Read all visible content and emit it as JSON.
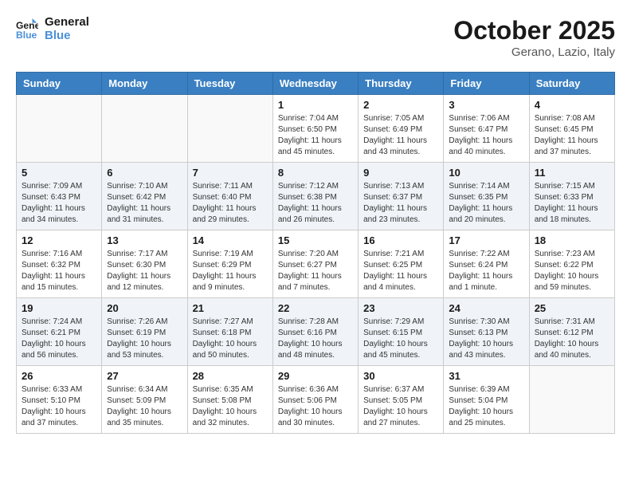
{
  "header": {
    "logo_line1": "General",
    "logo_line2": "Blue",
    "month": "October 2025",
    "location": "Gerano, Lazio, Italy"
  },
  "weekdays": [
    "Sunday",
    "Monday",
    "Tuesday",
    "Wednesday",
    "Thursday",
    "Friday",
    "Saturday"
  ],
  "weeks": [
    [
      {
        "day": "",
        "info": ""
      },
      {
        "day": "",
        "info": ""
      },
      {
        "day": "",
        "info": ""
      },
      {
        "day": "1",
        "info": "Sunrise: 7:04 AM\nSunset: 6:50 PM\nDaylight: 11 hours\nand 45 minutes."
      },
      {
        "day": "2",
        "info": "Sunrise: 7:05 AM\nSunset: 6:49 PM\nDaylight: 11 hours\nand 43 minutes."
      },
      {
        "day": "3",
        "info": "Sunrise: 7:06 AM\nSunset: 6:47 PM\nDaylight: 11 hours\nand 40 minutes."
      },
      {
        "day": "4",
        "info": "Sunrise: 7:08 AM\nSunset: 6:45 PM\nDaylight: 11 hours\nand 37 minutes."
      }
    ],
    [
      {
        "day": "5",
        "info": "Sunrise: 7:09 AM\nSunset: 6:43 PM\nDaylight: 11 hours\nand 34 minutes."
      },
      {
        "day": "6",
        "info": "Sunrise: 7:10 AM\nSunset: 6:42 PM\nDaylight: 11 hours\nand 31 minutes."
      },
      {
        "day": "7",
        "info": "Sunrise: 7:11 AM\nSunset: 6:40 PM\nDaylight: 11 hours\nand 29 minutes."
      },
      {
        "day": "8",
        "info": "Sunrise: 7:12 AM\nSunset: 6:38 PM\nDaylight: 11 hours\nand 26 minutes."
      },
      {
        "day": "9",
        "info": "Sunrise: 7:13 AM\nSunset: 6:37 PM\nDaylight: 11 hours\nand 23 minutes."
      },
      {
        "day": "10",
        "info": "Sunrise: 7:14 AM\nSunset: 6:35 PM\nDaylight: 11 hours\nand 20 minutes."
      },
      {
        "day": "11",
        "info": "Sunrise: 7:15 AM\nSunset: 6:33 PM\nDaylight: 11 hours\nand 18 minutes."
      }
    ],
    [
      {
        "day": "12",
        "info": "Sunrise: 7:16 AM\nSunset: 6:32 PM\nDaylight: 11 hours\nand 15 minutes."
      },
      {
        "day": "13",
        "info": "Sunrise: 7:17 AM\nSunset: 6:30 PM\nDaylight: 11 hours\nand 12 minutes."
      },
      {
        "day": "14",
        "info": "Sunrise: 7:19 AM\nSunset: 6:29 PM\nDaylight: 11 hours\nand 9 minutes."
      },
      {
        "day": "15",
        "info": "Sunrise: 7:20 AM\nSunset: 6:27 PM\nDaylight: 11 hours\nand 7 minutes."
      },
      {
        "day": "16",
        "info": "Sunrise: 7:21 AM\nSunset: 6:25 PM\nDaylight: 11 hours\nand 4 minutes."
      },
      {
        "day": "17",
        "info": "Sunrise: 7:22 AM\nSunset: 6:24 PM\nDaylight: 11 hours\nand 1 minute."
      },
      {
        "day": "18",
        "info": "Sunrise: 7:23 AM\nSunset: 6:22 PM\nDaylight: 10 hours\nand 59 minutes."
      }
    ],
    [
      {
        "day": "19",
        "info": "Sunrise: 7:24 AM\nSunset: 6:21 PM\nDaylight: 10 hours\nand 56 minutes."
      },
      {
        "day": "20",
        "info": "Sunrise: 7:26 AM\nSunset: 6:19 PM\nDaylight: 10 hours\nand 53 minutes."
      },
      {
        "day": "21",
        "info": "Sunrise: 7:27 AM\nSunset: 6:18 PM\nDaylight: 10 hours\nand 50 minutes."
      },
      {
        "day": "22",
        "info": "Sunrise: 7:28 AM\nSunset: 6:16 PM\nDaylight: 10 hours\nand 48 minutes."
      },
      {
        "day": "23",
        "info": "Sunrise: 7:29 AM\nSunset: 6:15 PM\nDaylight: 10 hours\nand 45 minutes."
      },
      {
        "day": "24",
        "info": "Sunrise: 7:30 AM\nSunset: 6:13 PM\nDaylight: 10 hours\nand 43 minutes."
      },
      {
        "day": "25",
        "info": "Sunrise: 7:31 AM\nSunset: 6:12 PM\nDaylight: 10 hours\nand 40 minutes."
      }
    ],
    [
      {
        "day": "26",
        "info": "Sunrise: 6:33 AM\nSunset: 5:10 PM\nDaylight: 10 hours\nand 37 minutes."
      },
      {
        "day": "27",
        "info": "Sunrise: 6:34 AM\nSunset: 5:09 PM\nDaylight: 10 hours\nand 35 minutes."
      },
      {
        "day": "28",
        "info": "Sunrise: 6:35 AM\nSunset: 5:08 PM\nDaylight: 10 hours\nand 32 minutes."
      },
      {
        "day": "29",
        "info": "Sunrise: 6:36 AM\nSunset: 5:06 PM\nDaylight: 10 hours\nand 30 minutes."
      },
      {
        "day": "30",
        "info": "Sunrise: 6:37 AM\nSunset: 5:05 PM\nDaylight: 10 hours\nand 27 minutes."
      },
      {
        "day": "31",
        "info": "Sunrise: 6:39 AM\nSunset: 5:04 PM\nDaylight: 10 hours\nand 25 minutes."
      },
      {
        "day": "",
        "info": ""
      }
    ]
  ]
}
